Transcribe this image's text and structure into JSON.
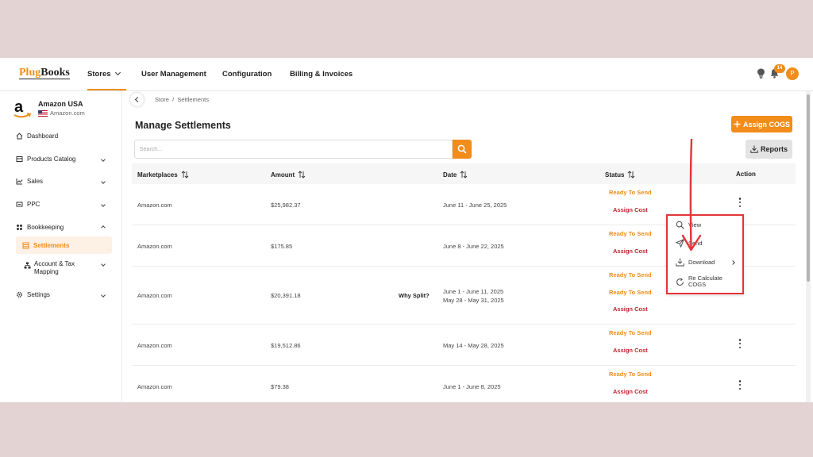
{
  "brand": {
    "logo_a": "Plug",
    "logo_b": "Books"
  },
  "nav": {
    "stores": "Stores",
    "user_management": "User Management",
    "configuration": "Configuration",
    "billing": "Billing & Invoices",
    "notification_count": "14",
    "avatar_initial": "P"
  },
  "store": {
    "name": "Amazon USA",
    "marketplace": "Amazon.com"
  },
  "sidebar": {
    "dashboard": "Dashboard",
    "products_catalog": "Products Catalog",
    "sales": "Sales",
    "ppc": "PPC",
    "bookkeeping": "Bookkeeping",
    "settlements": "Settlements",
    "account_tax_mapping": "Account & Tax Mapping",
    "settings": "Settings"
  },
  "breadcrumb": "Store  /  Settlements",
  "page": {
    "title": "Manage Settlements",
    "assign_cogs": "Assign COGS",
    "reports": "Reports",
    "search_placeholder": "Search..."
  },
  "table": {
    "headers": {
      "marketplaces": "Marketplaces",
      "amount": "Amount",
      "date": "Date",
      "status": "Status",
      "action": "Action"
    },
    "rows": [
      {
        "marketplace": "Amazon.com",
        "amount": "$25,982.37",
        "date": "June 11 - June 25, 2025",
        "status": "Ready To Send",
        "assign": "Assign Cost"
      },
      {
        "marketplace": "Amazon.com",
        "amount": "$175.85",
        "date": "June 8 - June 22, 2025",
        "status": "Ready To Send",
        "assign": "Assign Cost"
      },
      {
        "marketplace": "Amazon.com",
        "amount": "$20,391.18",
        "why_split": "Why Split?",
        "date1": "June 1 - June 11, 2025",
        "date2": "May 28 - May 31, 2025",
        "status1": "Ready To Send",
        "status2": "Ready To Send",
        "assign": "Assign Cost"
      },
      {
        "marketplace": "Amazon.com",
        "amount": "$19,512.86",
        "date": "May 14 - May 28, 2025",
        "status": "Ready To Send",
        "assign": "Assign Cost"
      },
      {
        "marketplace": "Amazon.com",
        "amount": "$79.38",
        "date": "June 1 - June 8, 2025",
        "status": "Ready To Send",
        "assign": "Assign Cost"
      }
    ]
  },
  "action_menu": {
    "view": "View",
    "send": "Send",
    "download": "Download",
    "recalc_line1": "Re Calculate",
    "recalc_line2": "COGS"
  },
  "colors": {
    "accent": "#f28c1a",
    "danger": "#c0262d",
    "annotation": "#e3353a",
    "frame_bg": "#e3d3d3"
  }
}
